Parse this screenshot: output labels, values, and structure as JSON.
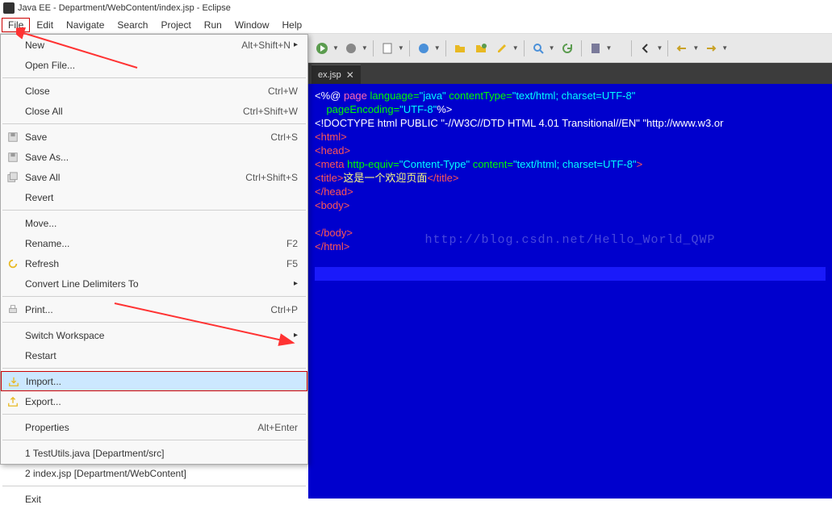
{
  "window": {
    "title": "Java EE - Department/WebContent/index.jsp - Eclipse"
  },
  "menubar": {
    "items": [
      "File",
      "Edit",
      "Navigate",
      "Search",
      "Project",
      "Run",
      "Window",
      "Help"
    ],
    "active_index": 0
  },
  "file_menu": {
    "groups": [
      [
        {
          "label": "New",
          "shortcut": "Alt+Shift+N",
          "submenu": true,
          "icon": ""
        },
        {
          "label": "Open File...",
          "shortcut": "",
          "icon": ""
        }
      ],
      [
        {
          "label": "Close",
          "shortcut": "Ctrl+W",
          "icon": ""
        },
        {
          "label": "Close All",
          "shortcut": "Ctrl+Shift+W",
          "icon": ""
        }
      ],
      [
        {
          "label": "Save",
          "shortcut": "Ctrl+S",
          "icon": "save"
        },
        {
          "label": "Save As...",
          "shortcut": "",
          "icon": "save"
        },
        {
          "label": "Save All",
          "shortcut": "Ctrl+Shift+S",
          "icon": "saveall"
        },
        {
          "label": "Revert",
          "shortcut": "",
          "icon": ""
        }
      ],
      [
        {
          "label": "Move...",
          "shortcut": "",
          "icon": ""
        },
        {
          "label": "Rename...",
          "shortcut": "F2",
          "icon": ""
        },
        {
          "label": "Refresh",
          "shortcut": "F5",
          "icon": "refresh"
        },
        {
          "label": "Convert Line Delimiters To",
          "shortcut": "",
          "submenu": true,
          "icon": ""
        }
      ],
      [
        {
          "label": "Print...",
          "shortcut": "Ctrl+P",
          "icon": "print"
        }
      ],
      [
        {
          "label": "Switch Workspace",
          "shortcut": "",
          "submenu": true,
          "icon": ""
        },
        {
          "label": "Restart",
          "shortcut": "",
          "icon": ""
        }
      ],
      [
        {
          "label": "Import...",
          "shortcut": "",
          "icon": "import",
          "selected": true
        },
        {
          "label": "Export...",
          "shortcut": "",
          "icon": "export"
        }
      ],
      [
        {
          "label": "Properties",
          "shortcut": "Alt+Enter",
          "icon": ""
        }
      ],
      [
        {
          "label": "1 TestUtils.java  [Department/src]",
          "shortcut": "",
          "icon": ""
        },
        {
          "label": "2 index.jsp  [Department/WebContent]",
          "shortcut": "",
          "icon": ""
        }
      ],
      [
        {
          "label": "Exit",
          "shortcut": "",
          "icon": ""
        }
      ]
    ]
  },
  "editor": {
    "tab_label": "ex.jsp",
    "code": {
      "lines": [
        {
          "tokens": [
            {
              "t": "<%@ ",
              "c": "tk-white"
            },
            {
              "t": "page",
              "c": "tk-attr"
            },
            {
              "t": " language=",
              "c": "tk-keyword"
            },
            {
              "t": "\"java\"",
              "c": "tk-string"
            },
            {
              "t": " contentType=",
              "c": "tk-keyword"
            },
            {
              "t": "\"text/html; charset=UTF-8\"",
              "c": "tk-string"
            }
          ]
        },
        {
          "tokens": [
            {
              "t": "    pageEncoding=",
              "c": "tk-keyword"
            },
            {
              "t": "\"UTF-8\"",
              "c": "tk-string"
            },
            {
              "t": "%>",
              "c": "tk-white"
            }
          ]
        },
        {
          "tokens": [
            {
              "t": "<!DOCTYPE html PUBLIC \"-//W3C//DTD HTML 4.01 Transitional//EN\" \"http://www.w3.or",
              "c": "tk-white"
            }
          ]
        },
        {
          "tokens": [
            {
              "t": "<html>",
              "c": "tk-tag"
            }
          ]
        },
        {
          "tokens": [
            {
              "t": "<head>",
              "c": "tk-tag"
            }
          ]
        },
        {
          "tokens": [
            {
              "t": "<meta ",
              "c": "tk-tag"
            },
            {
              "t": "http-equiv=",
              "c": "tk-keyword"
            },
            {
              "t": "\"Content-Type\"",
              "c": "tk-string"
            },
            {
              "t": " content=",
              "c": "tk-keyword"
            },
            {
              "t": "\"text/html; charset=UTF-8\"",
              "c": "tk-string"
            },
            {
              "t": ">",
              "c": "tk-tag"
            }
          ]
        },
        {
          "tokens": [
            {
              "t": "<title>",
              "c": "tk-tag"
            },
            {
              "t": "这是一个欢迎页面",
              "c": "tk-cn"
            },
            {
              "t": "</title>",
              "c": "tk-tag"
            }
          ]
        },
        {
          "tokens": [
            {
              "t": "</head>",
              "c": "tk-tag"
            }
          ]
        },
        {
          "tokens": [
            {
              "t": "<body>",
              "c": "tk-tag"
            }
          ]
        },
        {
          "tokens": [
            {
              "t": "",
              "c": "tk-white"
            }
          ]
        },
        {
          "tokens": [
            {
              "t": "</body>",
              "c": "tk-tag"
            }
          ]
        },
        {
          "tokens": [
            {
              "t": "</html>",
              "c": "tk-tag"
            }
          ]
        }
      ]
    },
    "watermark": "http://blog.csdn.net/Hello_World_QWP"
  }
}
